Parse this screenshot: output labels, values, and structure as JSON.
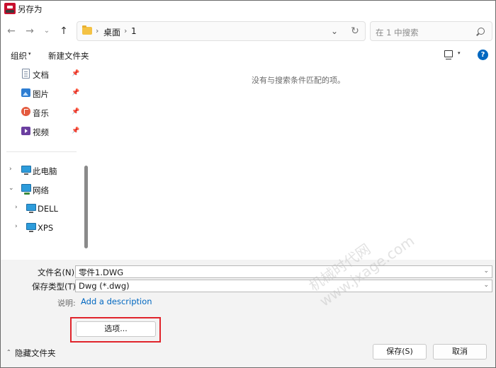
{
  "window": {
    "title": "另存为"
  },
  "nav": {
    "back_glyph": "←",
    "forward_glyph": "→",
    "recent_glyph": "⌄",
    "up_glyph": "↑"
  },
  "address": {
    "crumbs": [
      "桌面",
      "1"
    ],
    "separator": "›",
    "dropdown_glyph": "⌄",
    "refresh_glyph": "↻"
  },
  "search": {
    "placeholder": "在 1 中搜索"
  },
  "toolbar": {
    "organize_label": "组织",
    "organize_arrow": "▾",
    "new_folder_label": "新建文件夹",
    "view_arrow": "▾",
    "help_glyph": "?"
  },
  "sidebar": {
    "quick_access": [
      {
        "label": "文档",
        "icon": "document-icon"
      },
      {
        "label": "图片",
        "icon": "pictures-icon"
      },
      {
        "label": "音乐",
        "icon": "music-icon"
      },
      {
        "label": "视频",
        "icon": "videos-icon"
      }
    ],
    "pin_glyph": "📌",
    "this_pc": "此电脑",
    "network": "网络",
    "network_children": [
      "DELL",
      "XPS"
    ],
    "collapsed_glyph": "›",
    "expanded_glyph": "⌄"
  },
  "content": {
    "empty_message": "没有与搜索条件匹配的项。"
  },
  "form": {
    "filename_label": "文件名(N):",
    "filename_value": "零件1.DWG",
    "filetype_label": "保存类型(T):",
    "filetype_value": "Dwg (*.dwg)",
    "field_arrow": "⌄",
    "description_label": "说明:",
    "description_link": "Add a description",
    "options_button": "选项..."
  },
  "footer": {
    "hide_folders_label": "隐藏文件夹",
    "hide_folders_glyph": "⌃",
    "save_button": "保存(S)",
    "cancel_button": "取消"
  },
  "watermark": {
    "line1": "机械时代网",
    "line2": "www.jxage.com"
  },
  "colors": {
    "accent": "#0067c0",
    "highlight_border": "#e0242b"
  }
}
